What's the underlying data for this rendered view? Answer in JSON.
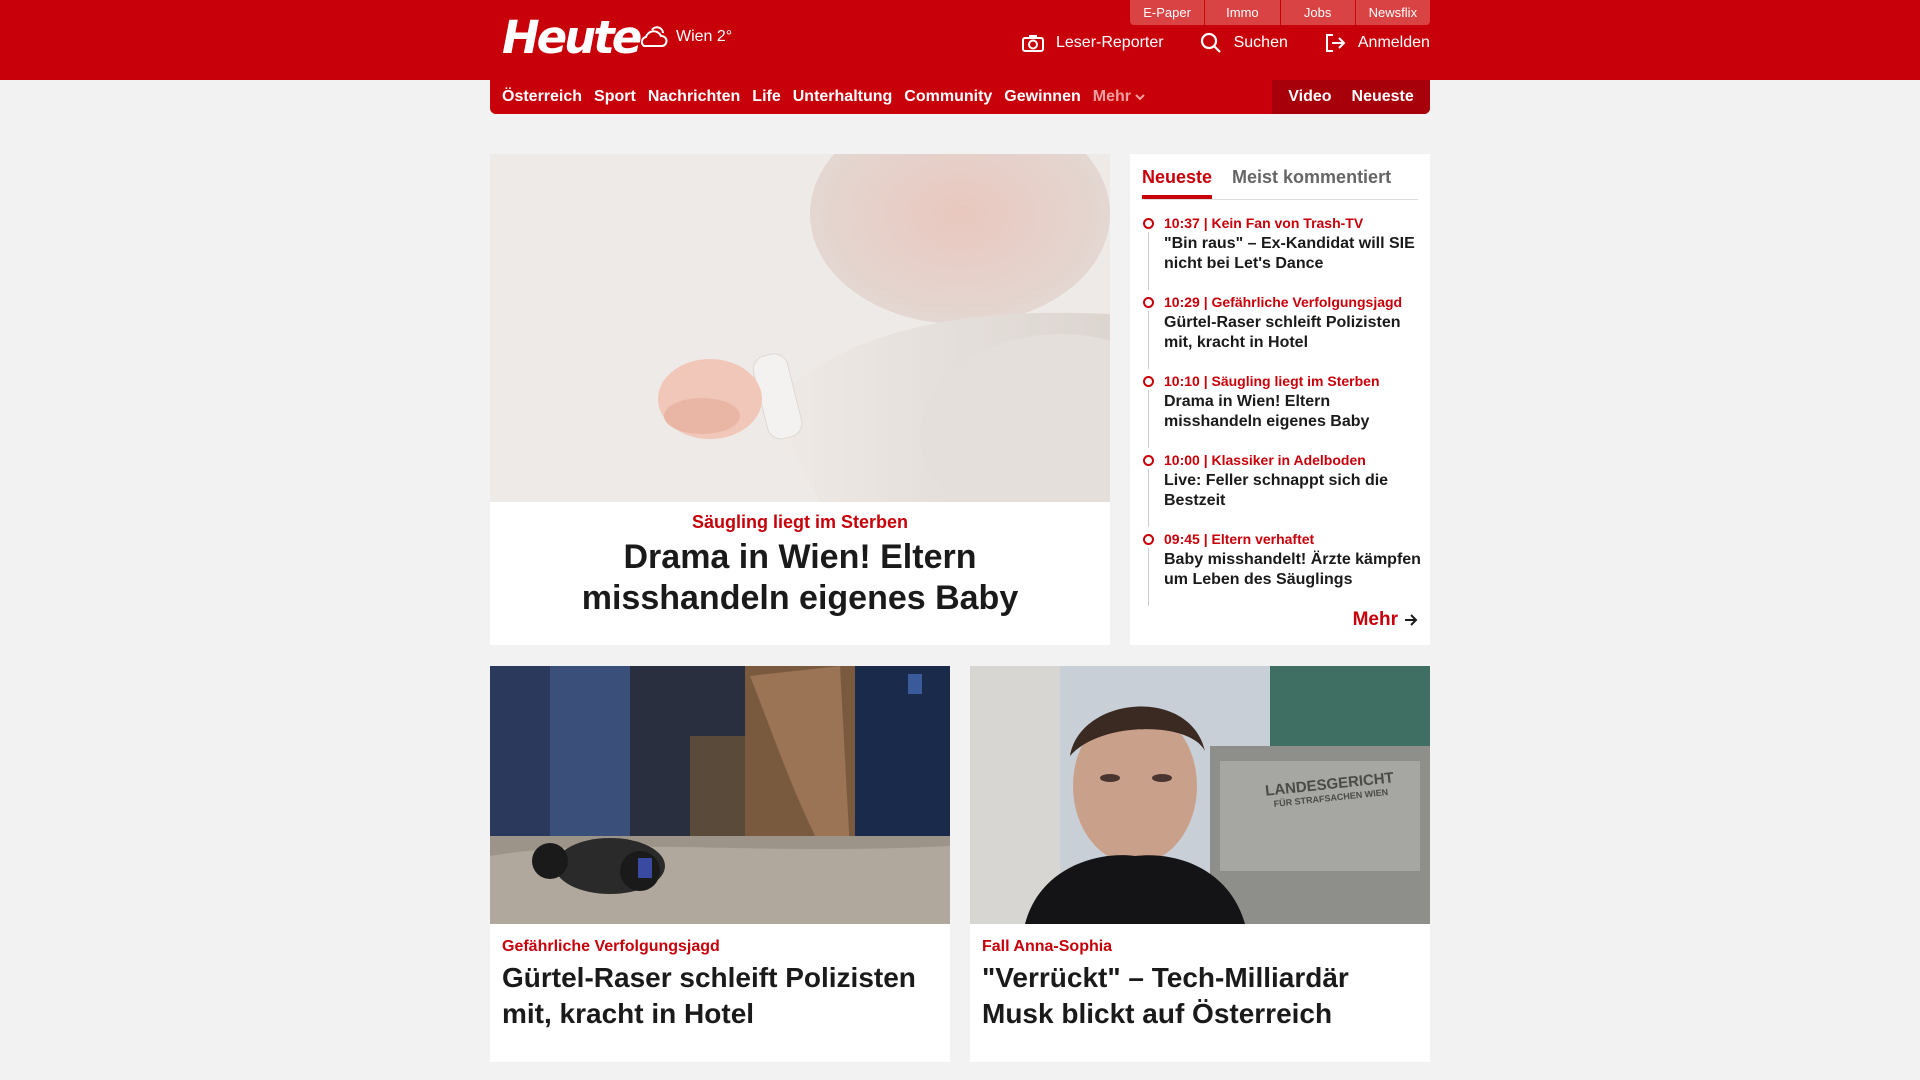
{
  "header": {
    "top_links": [
      "E-Paper",
      "Immo",
      "Jobs",
      "Newsflix"
    ],
    "logo_text": "Heute",
    "weather": {
      "location": "Wien 2°",
      "icon": "cloud-sun-icon"
    },
    "actions": [
      {
        "label": "Leser-Reporter",
        "icon": "camera-icon"
      },
      {
        "label": "Suchen",
        "icon": "search-icon"
      },
      {
        "label": "Anmelden",
        "icon": "login-icon"
      }
    ],
    "brand_color": "#c8000a"
  },
  "nav": {
    "items": [
      "Österreich",
      "Sport",
      "Nachrichten",
      "Life",
      "Unterhaltung",
      "Community",
      "Gewinnen"
    ],
    "more_label": "Mehr",
    "right_items": [
      "Video",
      "Neueste"
    ]
  },
  "hero": {
    "kicker": "Säugling liegt im Sterben",
    "title": "Drama in Wien! Eltern misshandeln eigenes Baby"
  },
  "sidebar": {
    "tabs": [
      "Neueste",
      "Meist kommentiert"
    ],
    "active_tab": "Neueste",
    "items": [
      {
        "meta": "10:37 | Kein Fan von Trash-TV",
        "title": "\"Bin raus\" – Ex-Kandidat will SIE nicht bei Let's Dance"
      },
      {
        "meta": "10:29 | Gefährliche Verfolgungsjagd",
        "title": "Gürtel-Raser schleift Polizisten mit, kracht in Hotel"
      },
      {
        "meta": "10:10 | Säugling liegt im Sterben",
        "title": "Drama in Wien! Eltern misshandeln eigenes Baby"
      },
      {
        "meta": "10:00 | Klassiker in Adelboden",
        "title": "Live: Feller schnappt sich die Bestzeit"
      },
      {
        "meta": "09:45 | Eltern verhaftet",
        "title": "Baby misshandelt! Ärzte kämpfen um Leben des Säuglings"
      }
    ],
    "more_label": "Mehr"
  },
  "cards": [
    {
      "kicker": "Gefährliche Verfolgungsjagd",
      "title": "Gürtel-Raser schleift Polizisten mit, kracht in Hotel"
    },
    {
      "kicker": "Fall Anna-Sophia",
      "title": "\"Verrückt\" – Tech-Milliardär Musk blickt auf Österreich"
    }
  ],
  "images": {
    "sign_line1": "LANDESGERICHT",
    "sign_line2": "FÜR STRAFSACHEN WIEN"
  }
}
